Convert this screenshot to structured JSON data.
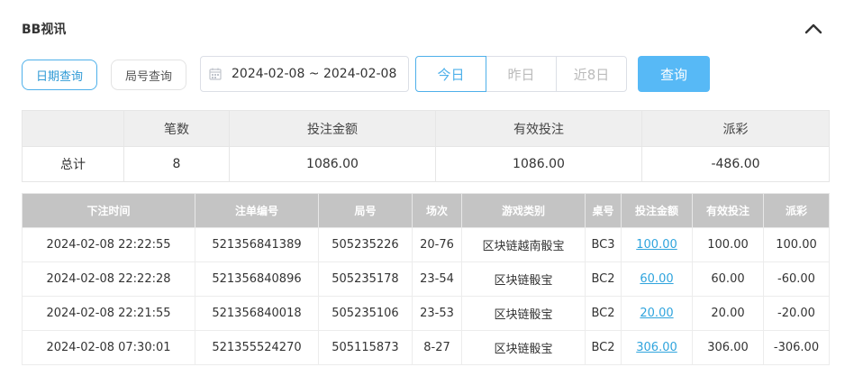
{
  "header": {
    "title": "BB视讯"
  },
  "filters": {
    "tab_date": "日期查询",
    "tab_round": "局号查询",
    "date_range": "2024-02-08 ~ 2024-02-08",
    "quick": [
      "今日",
      "昨日",
      "近8日"
    ],
    "query_label": "查询"
  },
  "summary": {
    "headers": [
      "",
      "笔数",
      "投注金额",
      "有效投注",
      "派彩"
    ],
    "row": {
      "label": "总计",
      "count": "8",
      "bet": "1086.00",
      "valid": "1086.00",
      "payout": "-486.00"
    }
  },
  "detail": {
    "headers": [
      "下注时间",
      "注单编号",
      "局号",
      "场次",
      "游戏类别",
      "桌号",
      "投注金额",
      "有效投注",
      "派彩"
    ],
    "rows": [
      {
        "time": "2024-02-08 22:22:55",
        "order": "521356841389",
        "round": "505235226",
        "session": "20-76",
        "game": "区块链越南骰宝",
        "table": "BC3",
        "bet": "100.00",
        "valid": "100.00",
        "payout": "100.00"
      },
      {
        "time": "2024-02-08 22:22:28",
        "order": "521356840896",
        "round": "505235178",
        "session": "23-54",
        "game": "区块链骰宝",
        "table": "BC2",
        "bet": "60.00",
        "valid": "60.00",
        "payout": "-60.00"
      },
      {
        "time": "2024-02-08 22:21:55",
        "order": "521356840018",
        "round": "505235106",
        "session": "23-53",
        "game": "区块链骰宝",
        "table": "BC2",
        "bet": "20.00",
        "valid": "20.00",
        "payout": "-20.00"
      },
      {
        "time": "2024-02-08 07:30:01",
        "order": "521355524270",
        "round": "505115873",
        "session": "8-27",
        "game": "区块链骰宝",
        "table": "BC2",
        "bet": "306.00",
        "valid": "306.00",
        "payout": "-306.00"
      }
    ]
  },
  "colors": {
    "accent": "#4eb0ea",
    "negative": "#e8443c",
    "primary_button": "#57b9f6"
  }
}
